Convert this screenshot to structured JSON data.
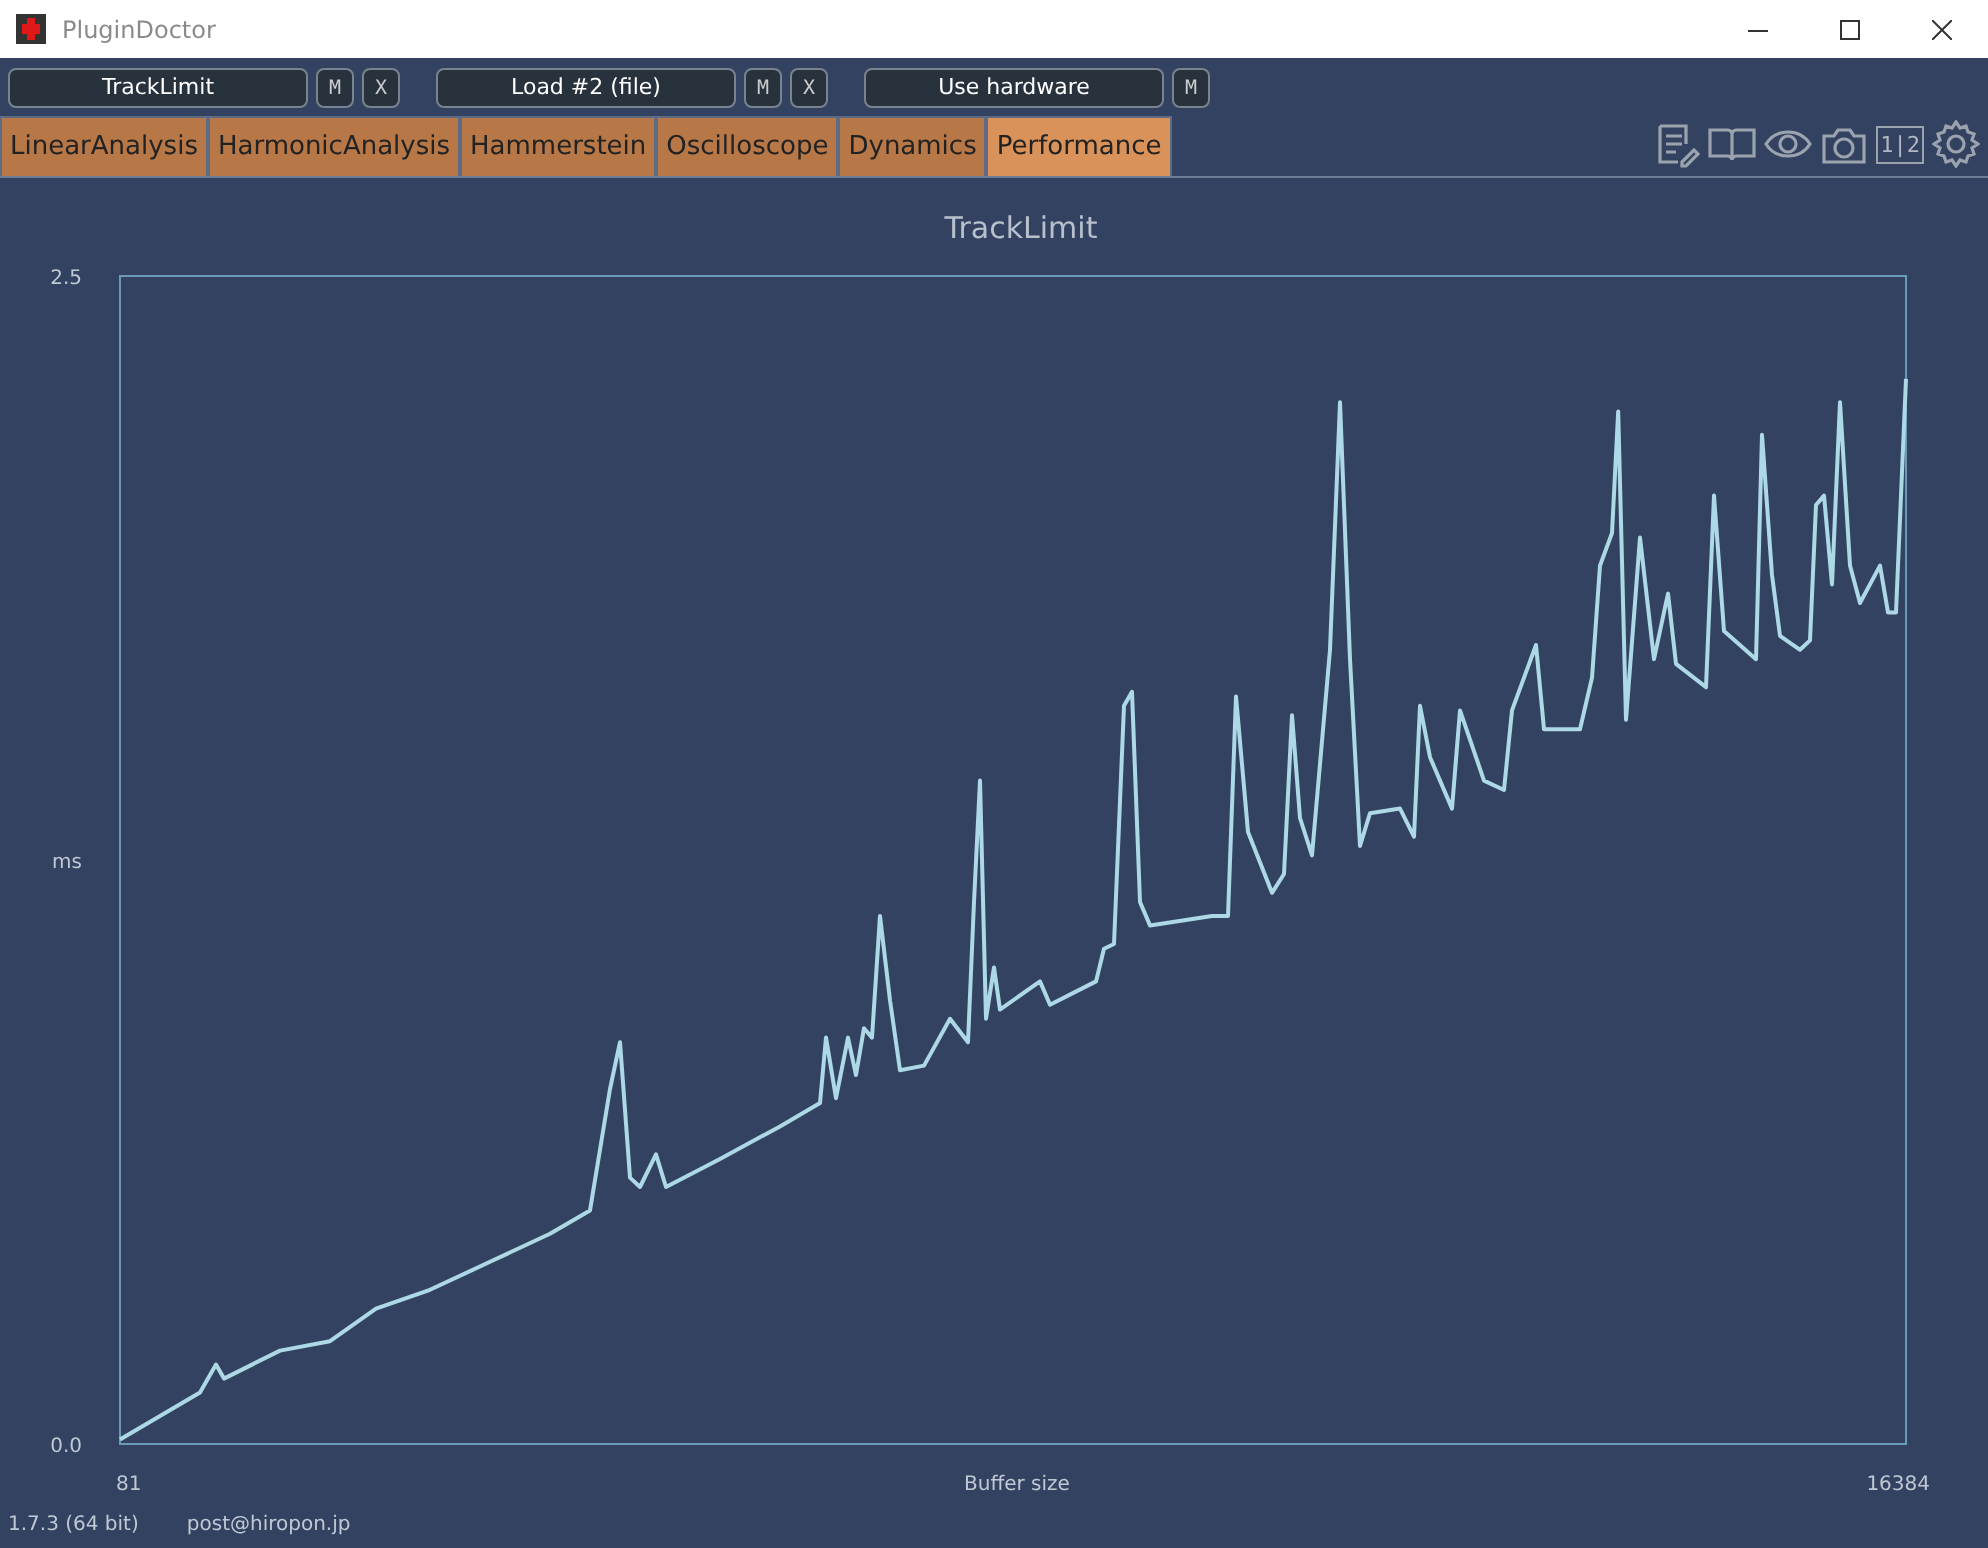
{
  "window": {
    "title": "PluginDoctor"
  },
  "toolbar": [
    {
      "label": "TrackLimit",
      "buttons": [
        "M",
        "X"
      ]
    },
    {
      "label": "Load #2 (file)",
      "buttons": [
        "M",
        "X"
      ]
    },
    {
      "label": "Use hardware",
      "buttons": [
        "M"
      ]
    }
  ],
  "tabs": [
    {
      "label": "LinearAnalysis",
      "selected": false
    },
    {
      "label": "HarmonicAnalysis",
      "selected": false
    },
    {
      "label": "Hammerstein",
      "selected": false
    },
    {
      "label": "Oscilloscope",
      "selected": false
    },
    {
      "label": "Dynamics",
      "selected": false
    },
    {
      "label": "Performance",
      "selected": true
    }
  ],
  "tools": {
    "compare_label": "1|2"
  },
  "chart": {
    "chart_data": {
      "type": "line",
      "title": "TrackLimit",
      "xlabel": "Buffer size",
      "ylabel": "ms",
      "xlim": [
        81,
        16384
      ],
      "ylim": [
        0,
        2.5
      ],
      "xticks": [
        81,
        16384
      ],
      "yticks": [
        {
          "value": 0,
          "label": "0.0"
        },
        {
          "value": 2.5,
          "label": "2.5"
        }
      ],
      "x": [
        81,
        446,
        811,
        957,
        1030,
        1286,
        1542,
        1998,
        2418,
        2911,
        3459,
        4006,
        4371,
        4554,
        4645,
        4737,
        4828,
        4974,
        5065,
        5558,
        6106,
        6471,
        6526,
        6617,
        6727,
        6800,
        6873,
        6946,
        7019,
        7110,
        7201,
        7420,
        7658,
        7822,
        7877,
        7932,
        7986,
        8059,
        8114,
        8479,
        8571,
        8990,
        9063,
        9155,
        9246,
        9319,
        9392,
        9483,
        10049,
        10195,
        10268,
        10378,
        10597,
        10707,
        10780,
        10853,
        10962,
        11126,
        11218,
        11309,
        11400,
        11492,
        11765,
        11893,
        11948,
        12039,
        12240,
        12313,
        12532,
        12715,
        12788,
        13007,
        13080,
        13409,
        13518,
        13591,
        13701,
        13756,
        13829,
        13956,
        14084,
        14212,
        14285,
        14559,
        14632,
        14723,
        15015,
        15070,
        15161,
        15234,
        15417,
        15508,
        15563,
        15636,
        15709,
        15782,
        15873,
        15965,
        16147,
        16220,
        16293,
        16384
      ],
      "series": [
        {
          "color": "#add8e6",
          "values": [
            0.01,
            0.06,
            0.11,
            0.17,
            0.14,
            0.17,
            0.2,
            0.22,
            0.29,
            0.33,
            0.39,
            0.45,
            0.5,
            0.76,
            0.86,
            0.57,
            0.55,
            0.62,
            0.55,
            0.61,
            0.68,
            0.73,
            0.87,
            0.74,
            0.87,
            0.79,
            0.89,
            0.87,
            1.13,
            0.95,
            0.8,
            0.81,
            0.91,
            0.86,
            1.16,
            1.42,
            0.91,
            1.02,
            0.93,
            0.99,
            0.94,
            0.99,
            1.06,
            1.07,
            1.58,
            1.61,
            1.16,
            1.11,
            1.13,
            1.13,
            1.6,
            1.31,
            1.18,
            1.22,
            1.56,
            1.34,
            1.26,
            1.7,
            2.23,
            1.68,
            1.28,
            1.35,
            1.36,
            1.3,
            1.58,
            1.47,
            1.36,
            1.57,
            1.42,
            1.4,
            1.57,
            1.71,
            1.53,
            1.53,
            1.64,
            1.88,
            1.95,
            2.21,
            1.55,
            1.94,
            1.68,
            1.82,
            1.67,
            1.62,
            2.03,
            1.74,
            1.68,
            2.16,
            1.86,
            1.73,
            1.7,
            1.72,
            2.01,
            2.03,
            1.84,
            2.23,
            1.88,
            1.8,
            1.88,
            1.78,
            1.78,
            2.28
          ]
        }
      ]
    }
  },
  "status_bar": {
    "version": "1.7.3 (64 bit)",
    "contact": "post@hiropon.jp"
  }
}
